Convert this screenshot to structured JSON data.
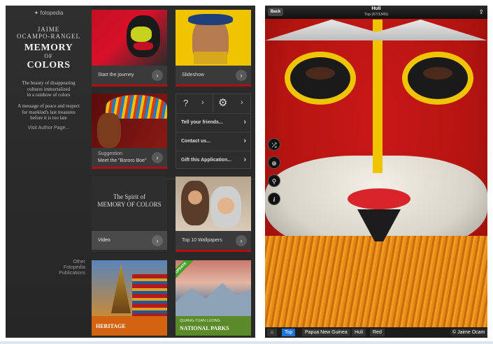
{
  "left": {
    "logo_text": "fotopedia",
    "author_line1": "JAIME",
    "author_line2": "OCAMPO-RANGEL",
    "title_line1": "MEMORY",
    "title_line2": "OF",
    "title_line3": "COLORS",
    "blurb1_l1": "The beauty of disappearing",
    "blurb1_l2": "cultures immortalized",
    "blurb1_l3": "in a rainbow of colors",
    "blurb2_l1": "A message of peace and respect",
    "blurb2_l2": "for mankind's last treasures",
    "blurb2_l3": "before it is too late",
    "visit_author": "Visit Author Page...",
    "other_l1": "Other",
    "other_l2": "Fotopedia",
    "other_l3": "Publications",
    "tiles": {
      "start": "Start the journey",
      "slideshow": "Slideshow",
      "suggestion_label": "Suggestion",
      "suggestion_title": "Meet the \"Bororo Boe\"",
      "video_title_l1": "The Spirit of",
      "video_title_l2": "MEMORY OF COLORS",
      "video": "Video",
      "wallpapers": "Top 10 Wallpapers",
      "heritage": "HERITAGE",
      "np_author": "QUANG-TUAN LUONG",
      "np_title": "NATIONAL PARKS",
      "np_badge": "UPDATE"
    },
    "menu": {
      "help": "?",
      "tell": "Tell your friends...",
      "contact": "Contact us...",
      "gift": "Gift this Application..."
    }
  },
  "right": {
    "back": "Back",
    "title": "Huli",
    "subtitle": "Top (67/1345)",
    "breadcrumbs": [
      "Top",
      "Papua New Guinea",
      "Huli",
      "Red"
    ],
    "credit": "© Jaime Ocam"
  },
  "colors": {
    "accent_blue": "#1e74d6",
    "red": "#b40e12",
    "yellow": "#f2c400"
  }
}
